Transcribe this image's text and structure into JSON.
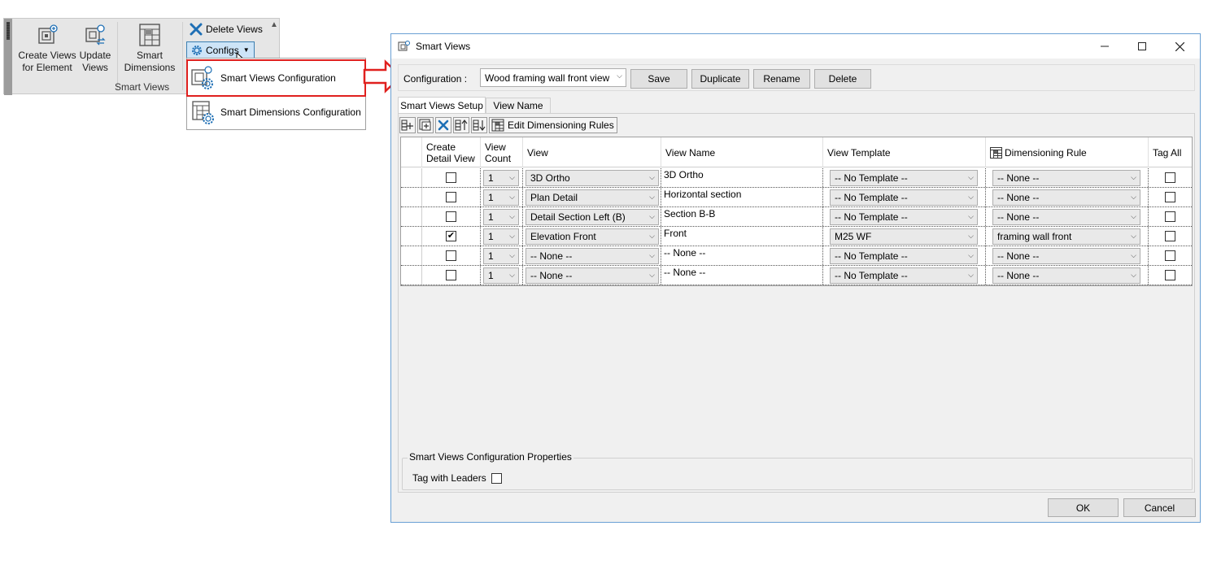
{
  "ribbon": {
    "create_views_line1": "Create Views",
    "create_views_line2": "for Element",
    "update_views_line1": "Update",
    "update_views_line2": "Views",
    "smart_dims_line1": "Smart",
    "smart_dims_line2": "Dimensions",
    "delete_views": "Delete Views",
    "configs": "Configs",
    "group_label": "Smart Views"
  },
  "menu": {
    "items": [
      {
        "label": "Smart Views Configuration",
        "highlighted": true
      },
      {
        "label": "Smart Dimensions Configuration",
        "highlighted": false
      }
    ]
  },
  "dialog": {
    "title": "Smart Views",
    "config_label": "Configuration  :",
    "config_value": "Wood framing wall front view",
    "buttons": {
      "save": "Save",
      "duplicate": "Duplicate",
      "rename": "Rename",
      "delete": "Delete"
    },
    "tabs": [
      "Smart Views Setup",
      "View Name"
    ],
    "toolbar": {
      "edit_dim_rules": "Edit Dimensioning Rules"
    },
    "columns": {
      "create_detail_l1": "Create",
      "create_detail_l2": "Detail View",
      "view_count_l1": "View",
      "view_count_l2": "Count",
      "view": "View",
      "view_name": "View Name",
      "view_template": "View Template",
      "dimensioning_rule": "Dimensioning Rule",
      "tag_all": "Tag All"
    },
    "rows": [
      {
        "detail": false,
        "count": "1",
        "view": "3D Ortho",
        "name": "3D Ortho",
        "template": "-- No Template --",
        "rule": "-- None --",
        "tag": false
      },
      {
        "detail": false,
        "count": "1",
        "view": "Plan Detail",
        "name": "Horizontal section",
        "template": "-- No Template --",
        "rule": "-- None --",
        "tag": false
      },
      {
        "detail": false,
        "count": "1",
        "view": "Detail Section Left (B)",
        "name": "Section B-B",
        "template": "-- No Template --",
        "rule": "-- None --",
        "tag": false
      },
      {
        "detail": true,
        "count": "1",
        "view": "Elevation Front",
        "name": "Front",
        "template": "M25 WF",
        "rule": "framing wall front",
        "tag": false
      },
      {
        "detail": false,
        "count": "1",
        "view": "-- None --",
        "name": "-- None --",
        "template": "-- No Template --",
        "rule": "-- None --",
        "tag": false
      },
      {
        "detail": false,
        "count": "1",
        "view": "-- None --",
        "name": "-- None --",
        "template": "-- No Template --",
        "rule": "-- None --",
        "tag": false
      }
    ],
    "props": {
      "legend": "Smart Views Configuration Properties",
      "tag_with_leaders": "Tag with Leaders"
    },
    "ok": "OK",
    "cancel": "Cancel"
  },
  "colors": {
    "accent_red": "#e0201e",
    "dialog_border": "#6aa0d4",
    "icon_blue": "#1e6fb5"
  }
}
